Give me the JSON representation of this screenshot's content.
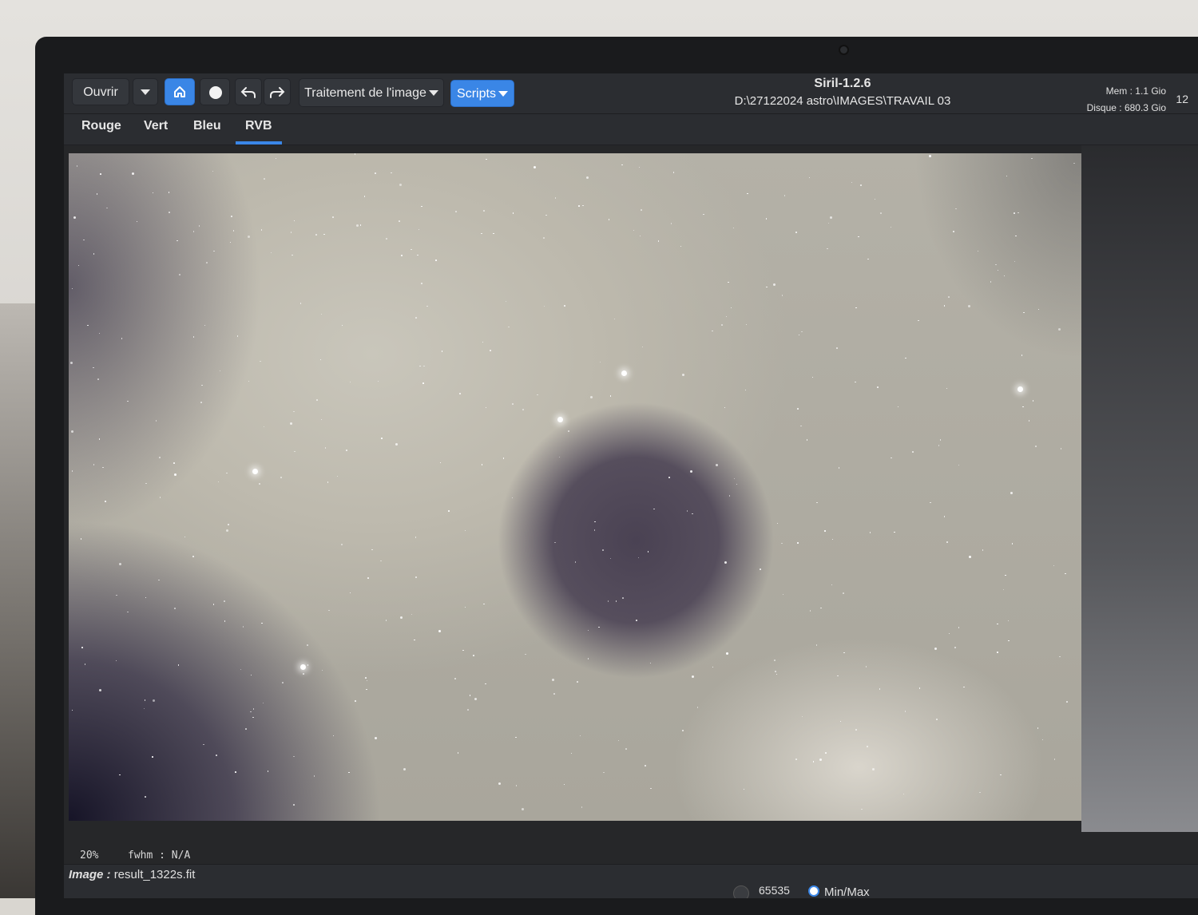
{
  "window": {
    "app_title": "Siril-1.2.6",
    "path": "D:\\27122024 astro\\IMAGES\\TRAVAIL 03"
  },
  "toolbar": {
    "open_label": "Ouvrir",
    "image_processing_label": "Traitement de l'image",
    "scripts_label": "Scripts"
  },
  "status": {
    "mem": "Mem : 1.1 Gio",
    "disk": "Disque : 680.3 Gio",
    "clock": "12"
  },
  "tabs": [
    {
      "label": "Rouge"
    },
    {
      "label": "Vert"
    },
    {
      "label": "Bleu"
    },
    {
      "label": "RVB",
      "active": true
    }
  ],
  "info": {
    "zoom": "20%",
    "fwhm": "fwhm : N/A"
  },
  "bottom": {
    "image_prefix": "Image :",
    "image_name": "result_1322s.fit",
    "max_value": "65535",
    "minmax_label": "Min/Max"
  },
  "colors": {
    "accent": "#3a86e6",
    "header_bg": "#2b2d31"
  },
  "icons": [
    "chevron-down-icon",
    "home-icon",
    "circle-icon",
    "undo-icon",
    "redo-icon"
  ]
}
